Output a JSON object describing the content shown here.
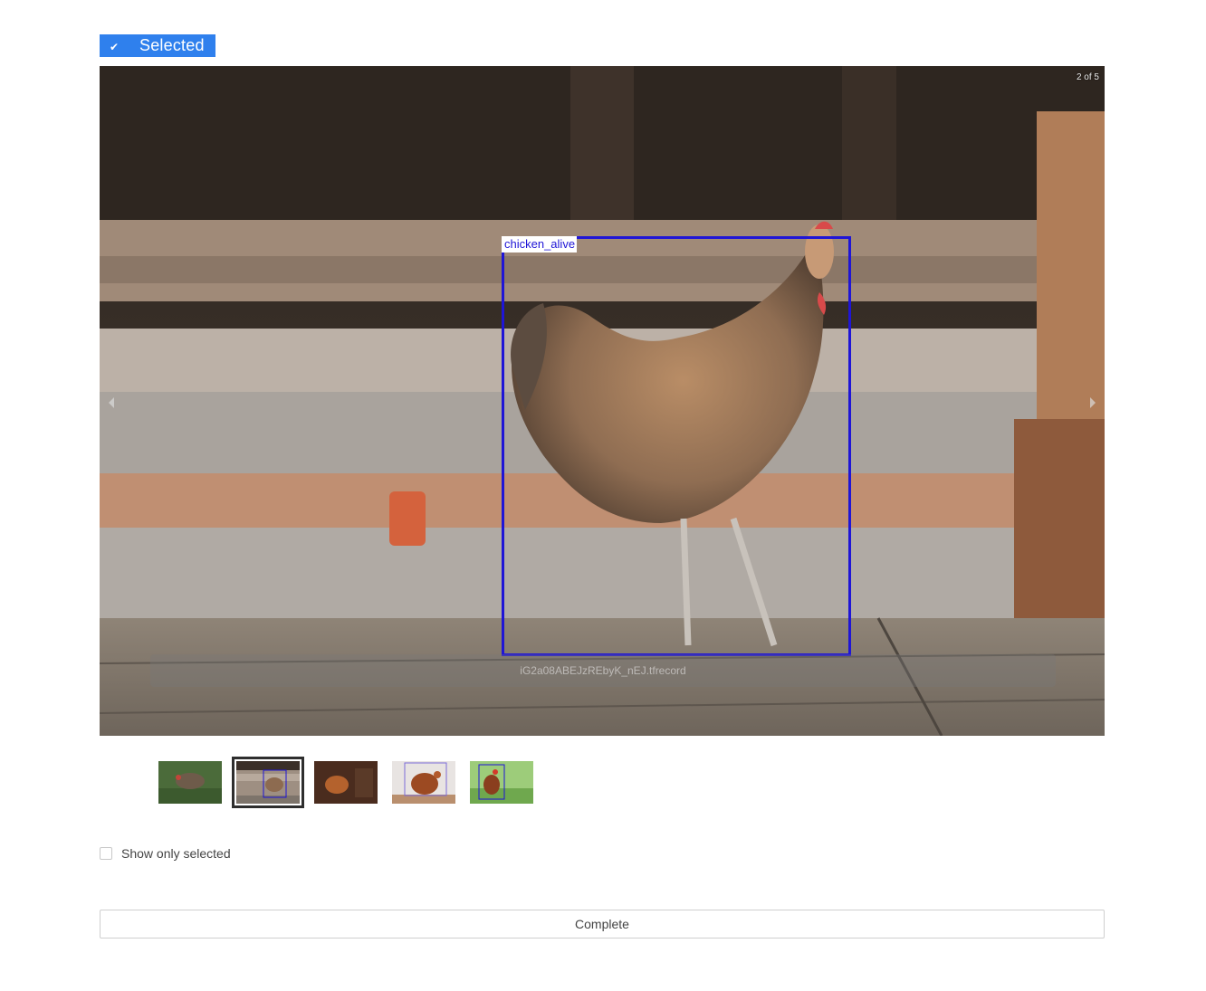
{
  "badge": {
    "label": "Selected",
    "icon": "check-icon"
  },
  "viewer": {
    "counter": "2 of 5",
    "annotation_label": "chicken_alive",
    "filename": "iG2a08ABEJzREbyK_nEJ.tfrecord",
    "box_color": "#1f15d6",
    "current_index": 2,
    "total": 5
  },
  "thumbnails": [
    {
      "name": "thumbnail-1",
      "active": false
    },
    {
      "name": "thumbnail-2",
      "active": true
    },
    {
      "name": "thumbnail-3",
      "active": false
    },
    {
      "name": "thumbnail-4",
      "active": false
    },
    {
      "name": "thumbnail-5",
      "active": false
    }
  ],
  "filter": {
    "show_only_selected_label": "Show only selected",
    "checked": false
  },
  "actions": {
    "complete_label": "Complete"
  },
  "colors": {
    "accent": "#2f80ed"
  }
}
